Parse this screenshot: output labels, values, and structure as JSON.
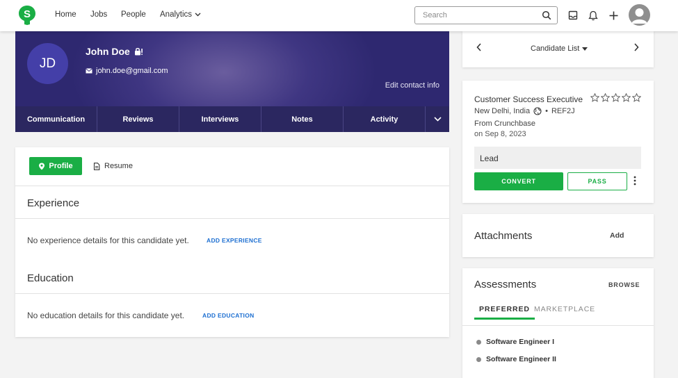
{
  "nav": {
    "items": [
      "Home",
      "Jobs",
      "People",
      "Analytics"
    ],
    "search_placeholder": "Search",
    "icons": [
      "inbox-icon",
      "bell-icon",
      "plus-icon",
      "user-avatar-icon"
    ],
    "brand_color": "#1aae45"
  },
  "candidate": {
    "initials": "JD",
    "name": "John Doe",
    "email": "john.doe@gmail.com",
    "edit_contact": "Edit contact info",
    "header_colors": {
      "primary": "#3f3682",
      "tabbar": "#2b2760",
      "avatar": "#443fa8"
    }
  },
  "tabs": [
    "Communication",
    "Reviews",
    "Interviews",
    "Notes",
    "Activity"
  ],
  "profile": {
    "profile_button": "Profile",
    "resume_button": "Resume",
    "experience": {
      "title": "Experience",
      "empty_text": "No experience details for this candidate yet.",
      "add_link": "ADD EXPERIENCE"
    },
    "education": {
      "title": "Education",
      "empty_text": "No education details for this candidate yet.",
      "add_link": "ADD EDUCATION"
    }
  },
  "candidate_list": {
    "label": "Candidate List"
  },
  "job": {
    "title": "Customer Success Executive",
    "location": "New Delhi, India",
    "separator": "•",
    "ref": "REF2J",
    "source": "From Crunchbase",
    "date": "on Sep 8, 2023",
    "rating": 0,
    "rating_max": 5,
    "stage": "Lead",
    "convert_button": "CONVERT",
    "pass_button": "PASS"
  },
  "attachments": {
    "title": "Attachments",
    "add_label": "Add"
  },
  "assessments": {
    "title": "Assessments",
    "browse_label": "BROWSE",
    "tabs": [
      "PREFERRED",
      "MARKETPLACE"
    ],
    "active_tab": "PREFERRED",
    "items": [
      "Software Engineer I",
      "Software Engineer II"
    ]
  }
}
